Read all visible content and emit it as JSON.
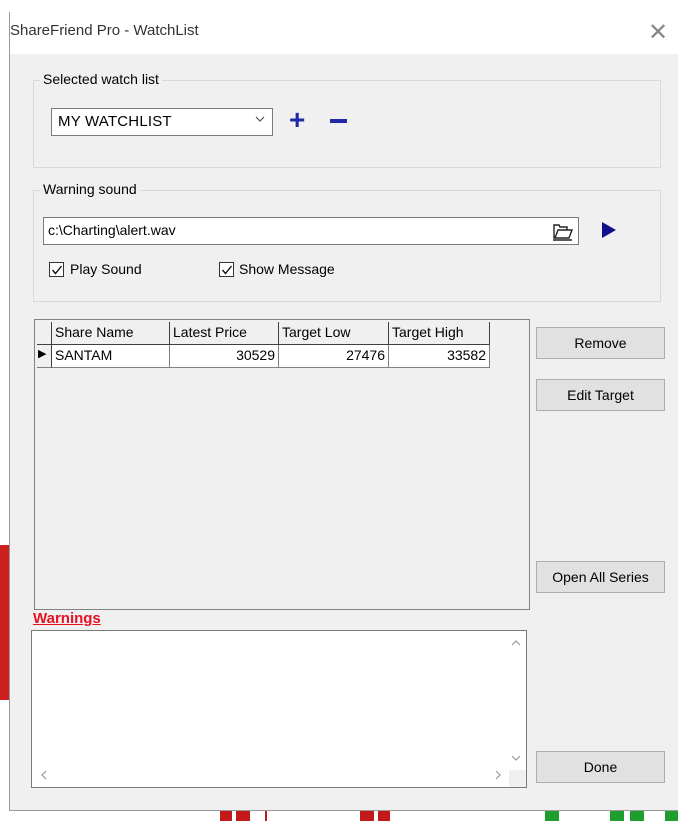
{
  "window": {
    "title": "ShareFriend Pro - WatchList",
    "close_glyph": "✕"
  },
  "watchlist_group": {
    "legend": "Selected watch list",
    "selected": "MY WATCHLIST",
    "add_glyph": "+",
    "remove_icon": "minus-icon"
  },
  "sound_group": {
    "legend": "Warning sound",
    "file_path": "c:\\Charting\\alert.wav",
    "play_sound_label": "Play Sound",
    "play_sound_checked": true,
    "show_message_label": "Show Message",
    "show_message_checked": true,
    "browse_icon": "folder-open-icon",
    "play_icon": "play-icon"
  },
  "grid": {
    "columns": [
      "Share Name",
      "Latest Price",
      "Target Low",
      "Target High"
    ],
    "rows": [
      {
        "indicator": "▶",
        "cells": [
          "SANTAM",
          "30529",
          "27476",
          "33582"
        ]
      }
    ]
  },
  "buttons": {
    "remove": "Remove",
    "edit_target": "Edit Target",
    "open_all_series": "Open All Series",
    "done": "Done"
  },
  "warnings": {
    "label": "Warnings",
    "text": ""
  },
  "colors": {
    "accent_blue": "#1f2aa6",
    "warning_red": "#e81123"
  }
}
